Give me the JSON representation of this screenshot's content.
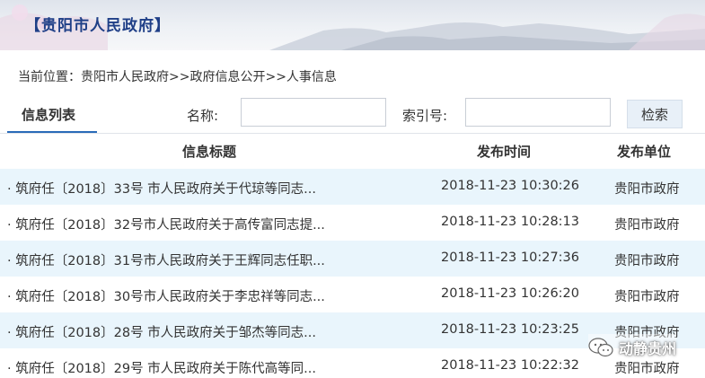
{
  "banner": {
    "title": "【贵阳市人民政府】"
  },
  "breadcrumb": {
    "text": "当前位置：贵阳市人民政府>>政府信息公开>>人事信息"
  },
  "toolbar": {
    "tab_label": "信息列表",
    "name_label": "名称:",
    "name_value": "",
    "index_label": "索引号:",
    "index_value": "",
    "search_label": "检索"
  },
  "table": {
    "headers": {
      "title": "信息标题",
      "time": "发布时间",
      "unit": "发布单位"
    },
    "rows": [
      {
        "title": "· 筑府任〔2018〕33号 市人民政府关于代琼等同志...",
        "time": "2018-11-23 10:30:26",
        "unit": "贵阳市政府"
      },
      {
        "title": "· 筑府任〔2018〕32号市人民政府关于高传富同志提...",
        "time": "2018-11-23 10:28:13",
        "unit": "贵阳市政府"
      },
      {
        "title": "· 筑府任〔2018〕31号市人民政府关于王辉同志任职...",
        "time": "2018-11-23 10:27:36",
        "unit": "贵阳市政府"
      },
      {
        "title": "· 筑府任〔2018〕30号市人民政府关于李忠祥等同志...",
        "time": "2018-11-23 10:26:20",
        "unit": "贵阳市政府"
      },
      {
        "title": "· 筑府任〔2018〕28号 市人民政府关于邹杰等同志...",
        "time": "2018-11-23 10:23:25",
        "unit": "贵阳市政府"
      },
      {
        "title": "· 筑府任〔2018〕29号 市人民政府关于陈代高等同...",
        "time": "2018-11-23 10:22:32",
        "unit": "贵阳市政府"
      }
    ]
  },
  "watermark": {
    "text": "动静贵州",
    "icon": "wechat-icon"
  },
  "colors": {
    "title_blue": "#1f3f87",
    "row_alt": "#e9f5fc",
    "tab_underline": "#2a6bb8"
  }
}
